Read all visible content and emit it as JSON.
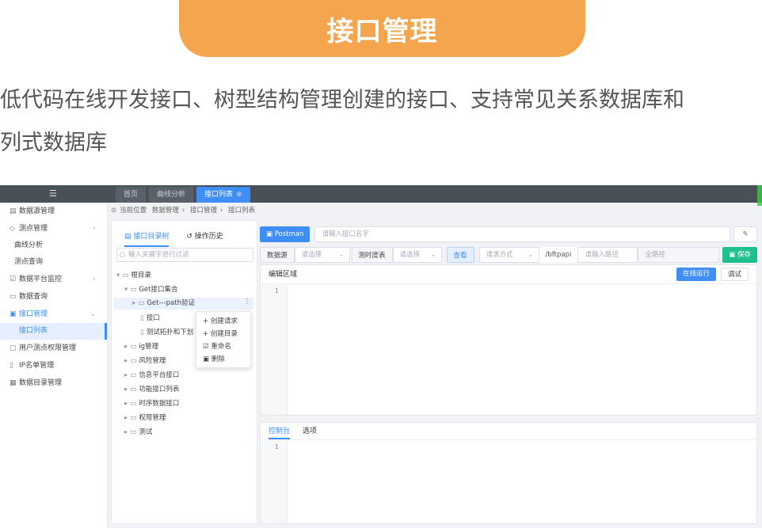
{
  "banner": {
    "title": "接口管理"
  },
  "description": {
    "line1": "低代码在线开发接口、树型结构管理创建的接口、支持常见关系数据库和",
    "line2": "列式数据库"
  },
  "topbar": {
    "tabs": [
      {
        "label": "首页"
      },
      {
        "label": "曲线分析"
      },
      {
        "label": "接口列表"
      }
    ]
  },
  "sidebar": {
    "items": [
      {
        "label": "数据源管理"
      },
      {
        "label": "测点管理"
      },
      {
        "label": "曲线分析"
      },
      {
        "label": "测点查询"
      },
      {
        "label": "数据平台监控"
      },
      {
        "label": "数据查询"
      },
      {
        "label": "接口管理"
      },
      {
        "label": "接口列表"
      },
      {
        "label": "用户测点权限管理"
      },
      {
        "label": "IP名单管理"
      },
      {
        "label": "数据目录管理"
      }
    ]
  },
  "breadcrumb": {
    "prefix": "当前位置",
    "items": [
      "数据管理",
      "接口管理",
      "接口列表"
    ]
  },
  "tree": {
    "tab_tree": "接口目录树",
    "tab_history": "操作历史",
    "search_placeholder": "输入关键字进行过滤",
    "nodes": [
      "根目录",
      "Get接口集合",
      "Get---path验证",
      "接口",
      "测试拓扑和下划",
      "ig管理",
      "风险管理",
      "信息平台接口",
      "功能接口列表",
      "时序数据接口",
      "权限管理",
      "测试"
    ],
    "context_menu": [
      "创建请求",
      "创建目录",
      "重命名",
      "删除"
    ]
  },
  "main": {
    "postman_label": "Postman",
    "interface_name_placeholder": "请输入接口名字",
    "datasource_label": "数据源",
    "select_placeholder": "请选择",
    "timeseries_label": "测时度表",
    "query_button": "查看",
    "method_placeholder": "请求方式",
    "path_prefix": "/bftpapi",
    "path_placeholder": "请输入路径",
    "full_path_placeholder": "全路径",
    "save_button": "保存",
    "editor_title": "编辑区域",
    "run_online_button": "在线运行",
    "debug_button": "调试",
    "line_number": "1",
    "console_tab": "控制台",
    "options_tab": "选项"
  }
}
